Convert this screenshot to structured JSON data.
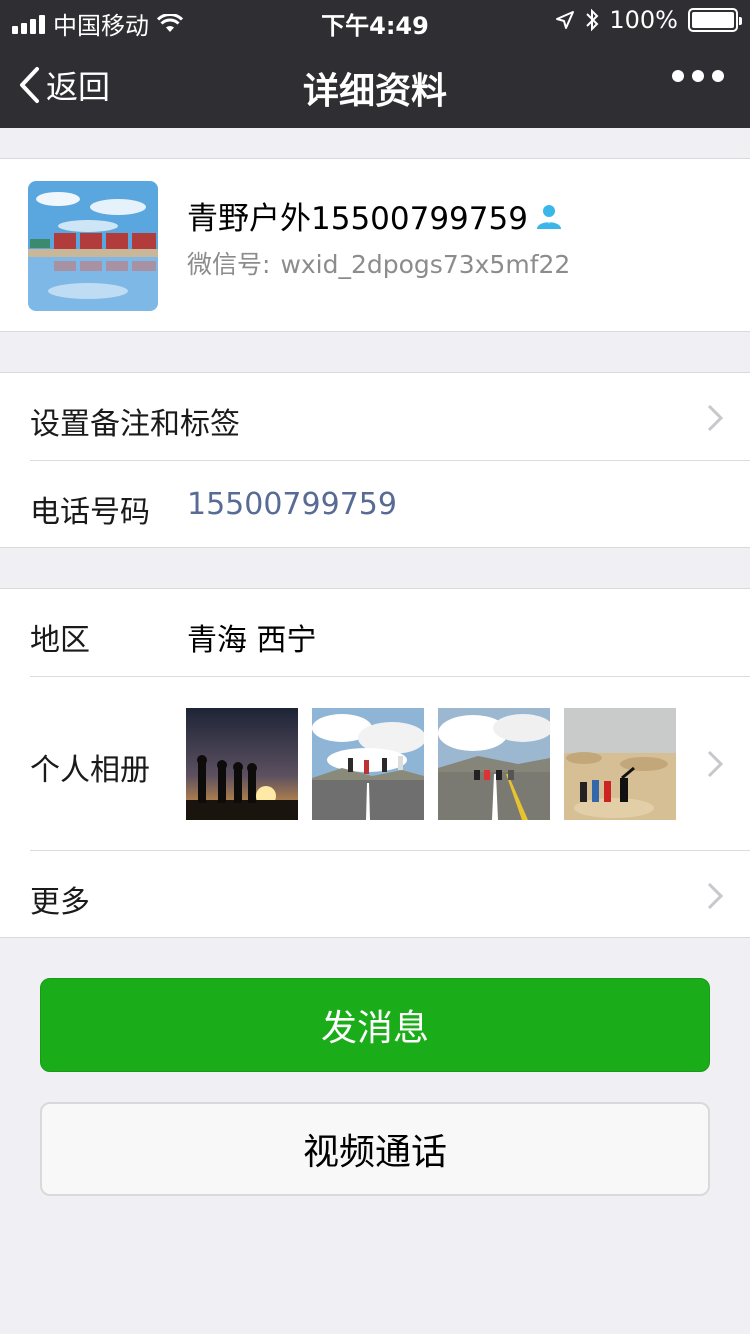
{
  "status_bar": {
    "carrier": "中国移动",
    "time": "下午4:49",
    "battery": "100%"
  },
  "nav": {
    "back_label": "返回",
    "title": "详细资料"
  },
  "profile": {
    "name": "青野户外15500799759",
    "wechat_id_label": "微信号:",
    "wechat_id": "wxid_2dpogs73x5mf22"
  },
  "rows": {
    "remark_label": "设置备注和标签",
    "phone_label": "电话号码",
    "phone_value": "15500799759",
    "region_label": "地区",
    "region_value": "青海 西宁",
    "album_label": "个人相册",
    "more_label": "更多"
  },
  "buttons": {
    "send_message": "发消息",
    "video_call": "视频通话"
  },
  "colors": {
    "nav_bg": "#2e2e33",
    "primary_green": "#1aad19",
    "link_blue": "#576b95",
    "contact_icon": "#3ab7e8"
  }
}
